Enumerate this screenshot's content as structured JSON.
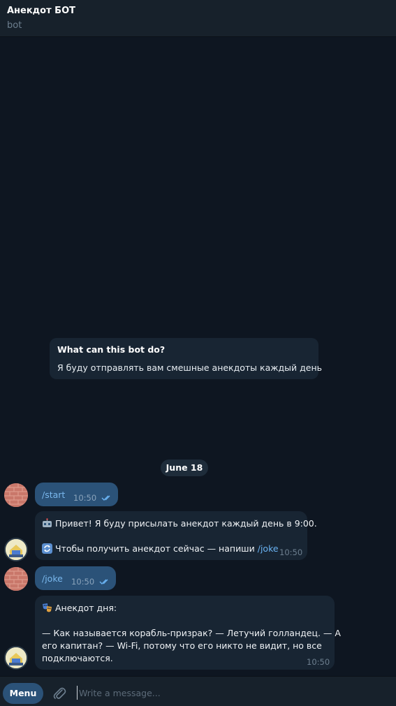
{
  "header": {
    "title": "Анекдот БОТ",
    "subtitle": "bot"
  },
  "info_card": {
    "heading": "What can this bot do?",
    "text": "Я буду отправлять вам смешные анекдоты каждый день"
  },
  "date_separator": "June 18",
  "messages": [
    {
      "from": "user",
      "text": "/start",
      "time": "10:50"
    },
    {
      "from": "bot",
      "line1": "Привет! Я буду присылать анекдот каждый день в 9:00.",
      "line2_prefix": "Чтобы получить анекдот сейчас — напиши ",
      "line2_link": "/joke",
      "time": "10:50"
    },
    {
      "from": "user",
      "text": "/joke",
      "time": "10:50"
    },
    {
      "from": "bot",
      "title": "Анекдот дня:",
      "body_line1": "— Как называется корабль-призрак? — Летучий голландец. — А",
      "body_line2": "его капитан? — Wi-Fi, потому что его никто не видит, но все",
      "body_line3": "подключаются.",
      "time": "10:50"
    }
  ],
  "composer": {
    "menu_label": "Menu",
    "placeholder": "Write a message..."
  },
  "colors": {
    "background": "#0e1621",
    "header": "#17212b",
    "outgoing_bubble": "#2b5278",
    "incoming_bubble": "#182533",
    "link": "#6ab3f3"
  },
  "icons": [
    "double-check-icon",
    "robot-emoji-icon",
    "refresh-emoji-icon",
    "theater-masks-emoji-icon",
    "paperclip-icon"
  ]
}
